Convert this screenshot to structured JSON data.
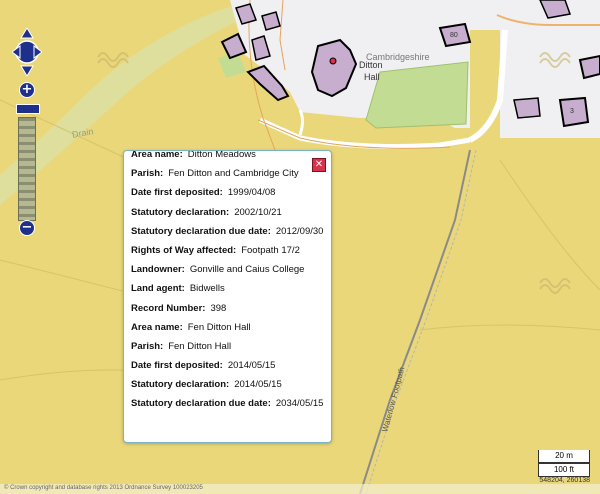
{
  "map": {
    "place_labels": {
      "cambridgeshire": "Cambridgeshire",
      "ditton": "Ditton",
      "hall": "Hall",
      "drain": "Drain",
      "waterlow_footpath": "Waterlow Footpath",
      "house_num_1": "80",
      "house_num_2": "3"
    },
    "copyright": "© Crown copyright and database rights 2013 Ordnance Survey 100023205",
    "scale_metric": "20 m",
    "scale_imperial": "100 ft",
    "coords": "548204, 260138",
    "colors": {
      "field": "#ead77a",
      "urban": "#f0f0f2",
      "green": "#c3dc93",
      "building": "#c8aece",
      "road": "#ffffff",
      "accent": "#1f2f8c"
    }
  },
  "controls": {
    "pan_icon": "pan-arrows-icon",
    "zoom_in": "+",
    "zoom_out": "−"
  },
  "popup": {
    "close_icon": "close-icon",
    "rows": [
      {
        "key": "Area name:",
        "value": "Ditton Meadows"
      },
      {
        "key": "Parish:",
        "value": "Fen Ditton and Cambridge City"
      },
      {
        "key": "Date first deposited:",
        "value": "1999/04/08"
      },
      {
        "key": "Statutory declaration:",
        "value": "2002/10/21"
      },
      {
        "key": "Statutory declaration due date:",
        "value": "2012/09/30"
      },
      {
        "key": "Rights of Way affected:",
        "value": "Footpath 17/2"
      },
      {
        "key": "Landowner:",
        "value": "Gonville and Caius College"
      },
      {
        "key": "Land agent:",
        "value": "Bidwells"
      },
      {
        "key": "Record Number:",
        "value": "398"
      },
      {
        "key": "Area name:",
        "value": "Fen Ditton Hall"
      },
      {
        "key": "Parish:",
        "value": "Fen Ditton Hall"
      },
      {
        "key": "Date first deposited:",
        "value": "2014/05/15"
      },
      {
        "key": "Statutory declaration:",
        "value": "2014/05/15"
      },
      {
        "key": "Statutory declaration due date:",
        "value": "2034/05/15"
      }
    ]
  }
}
